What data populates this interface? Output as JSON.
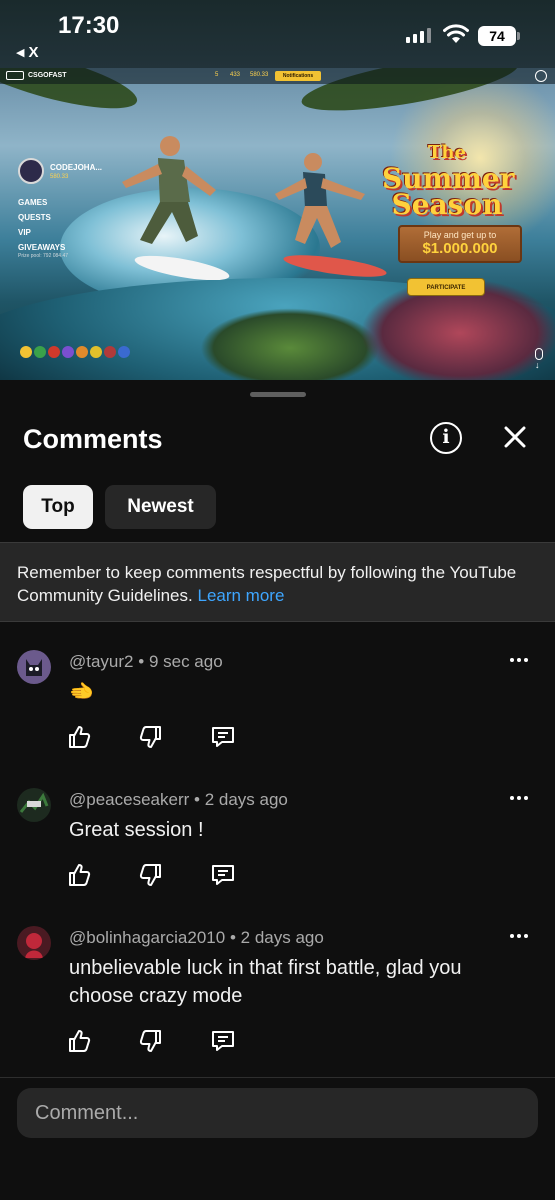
{
  "status_bar": {
    "time": "17:30",
    "back_label": "X",
    "battery": "74"
  },
  "video": {
    "site_brand": "CSGOFAST",
    "top_stats": [
      "5",
      "433",
      "580.33"
    ],
    "notif_button": "Notifications",
    "username": "CODEJOHA...",
    "balance": "580.33",
    "menu": [
      "GAMES",
      "QUESTS",
      "VIP",
      "GIVEAWAYS"
    ],
    "prize_pool": "Prize pool: 792 084.47",
    "promo_the": "The",
    "promo_title": "Summer Season",
    "promo_line1": "Play and get up to",
    "promo_amount": "$1.000.000",
    "participate": "PARTICIPATE"
  },
  "comments_panel": {
    "title": "Comments",
    "tabs": [
      {
        "label": "Top",
        "active": true
      },
      {
        "label": "Newest",
        "active": false
      }
    ],
    "guideline_text": "Remember to keep comments respectful by following the YouTube Community Guidelines.",
    "guideline_link": "Learn more",
    "comments": [
      {
        "author": "@tayur2",
        "time": "9 sec ago",
        "text": "🫲",
        "avatar_color": "#6b5a8c"
      },
      {
        "author": "@peaceseakerr",
        "time": "2 days ago",
        "text": "Great session !",
        "avatar_color": "#1d2a1f"
      },
      {
        "author": "@bolinhagarcia2010",
        "time": "2 days ago",
        "text": "unbelievable luck in that first battle, glad you choose crazy mode",
        "avatar_color": "#7a2434"
      }
    ],
    "composer_placeholder": "Comment..."
  },
  "colors": {
    "background": "#0f0f0f",
    "chip_active": "#f1f1f1",
    "chip_inactive": "#272727",
    "link": "#3ea6ff"
  }
}
